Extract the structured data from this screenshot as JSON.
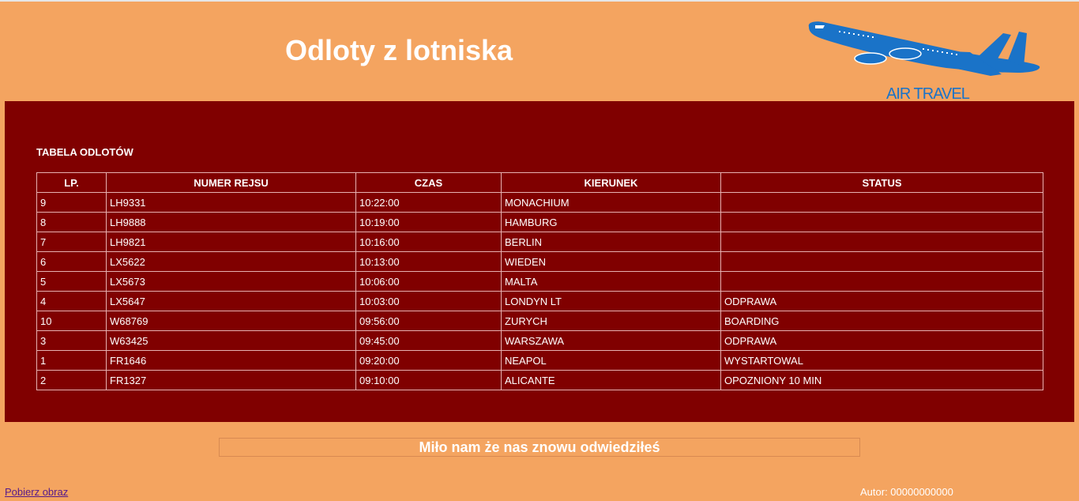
{
  "header": {
    "title": "Odloty z lotniska",
    "logo_text": "AIR TRAVEL",
    "logo_icon": "airplane-icon"
  },
  "main": {
    "caption": "TABELA ODLOTÓW",
    "columns": [
      "LP.",
      "NUMER REJSU",
      "CZAS",
      "KIERUNEK",
      "STATUS"
    ],
    "rows": [
      [
        "9",
        "LH9331",
        "10:22:00",
        "MONACHIUM",
        ""
      ],
      [
        "8",
        "LH9888",
        "10:19:00",
        "HAMBURG",
        ""
      ],
      [
        "7",
        "LH9821",
        "10:16:00",
        "BERLIN",
        ""
      ],
      [
        "6",
        "LX5622",
        "10:13:00",
        "WIEDEN",
        ""
      ],
      [
        "5",
        "LX5673",
        "10:06:00",
        "MALTA",
        ""
      ],
      [
        "4",
        "LX5647",
        "10:03:00",
        "LONDYN LT",
        "ODPRAWA"
      ],
      [
        "10",
        "W68769",
        "09:56:00",
        "ZURYCH",
        "BOARDING"
      ],
      [
        "3",
        "W63425",
        "09:45:00",
        "WARSZAWA",
        "ODPRAWA"
      ],
      [
        "1",
        "FR1646",
        "09:20:00",
        "NEAPOL",
        "WYSTARTOWAL"
      ],
      [
        "2",
        "FR1327",
        "09:10:00",
        "ALICANTE",
        "OPOZNIONY 10 MIN"
      ]
    ]
  },
  "footer": {
    "welcome": "Miło nam że nas znowu odwiedziłeś",
    "download_link": "Pobierz obraz",
    "author": "Autor: 00000000000"
  },
  "colors": {
    "page_bg": "#f4a460",
    "main_bg": "#800000",
    "logo_blue": "#1a73c8"
  }
}
